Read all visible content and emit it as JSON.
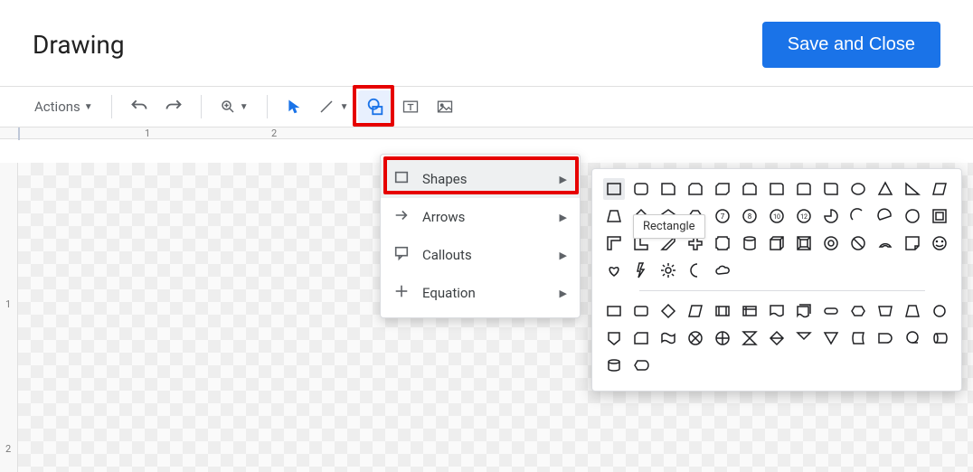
{
  "dialog": {
    "title": "Drawing",
    "save_label": "Save and Close"
  },
  "toolbar": {
    "actions_label": "Actions"
  },
  "ruler": {
    "ticks": [
      "1",
      "2"
    ],
    "vticks": [
      "1",
      "2"
    ]
  },
  "shapes_menu": {
    "items": [
      {
        "label": "Shapes"
      },
      {
        "label": "Arrows"
      },
      {
        "label": "Callouts"
      },
      {
        "label": "Equation"
      }
    ]
  },
  "tooltip": {
    "text": "Rectangle"
  },
  "gallery": {
    "tooltipped": "Rectangle"
  }
}
